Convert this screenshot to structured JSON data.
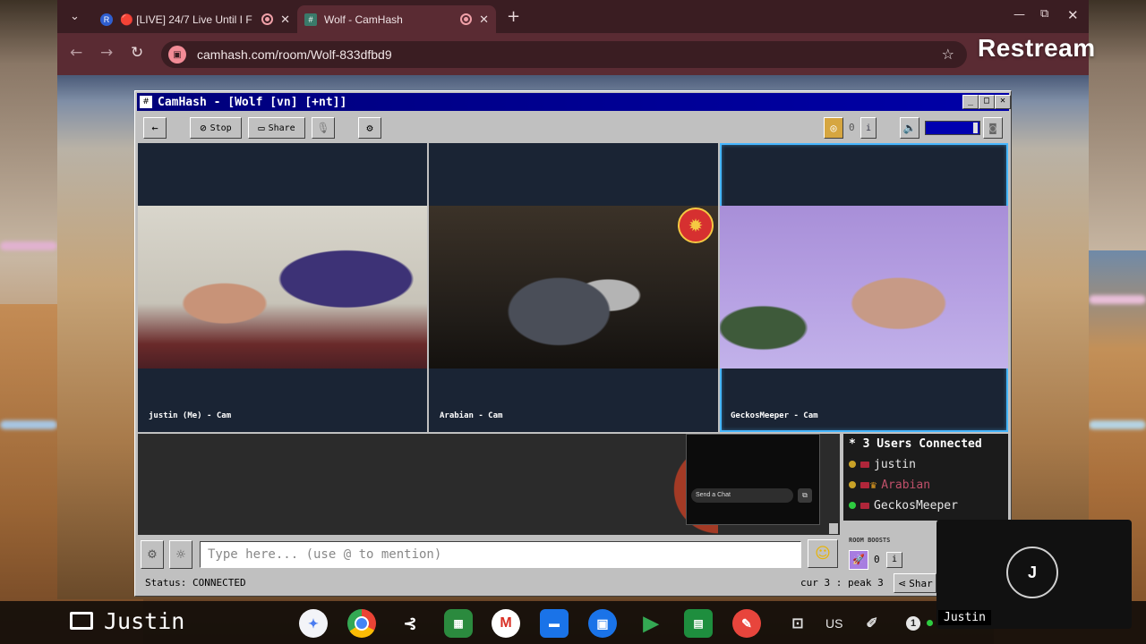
{
  "browser": {
    "tabs": [
      {
        "title": "🔴 [LIVE] 24/7 Live Until I F",
        "favicon": "R",
        "active": false
      },
      {
        "title": "Wolf - CamHash",
        "favicon": "#",
        "active": true
      }
    ],
    "url": "camhash.com/room/Wolf-833dfbd9"
  },
  "overlay": {
    "brand": "Restream"
  },
  "app": {
    "title": "CamHash - [Wolf [vn] [+nt]]",
    "toolbar": {
      "back_icon": "arrow-left-icon",
      "stop_label": "Stop",
      "share_label": "Share",
      "mic_icon": "microphone-icon",
      "settings_icon": "gear-icon",
      "coins_count": "0",
      "info_label": "i",
      "volume_icon": "speaker-icon",
      "camera_icon": "camera-icon"
    },
    "cams": [
      {
        "caption": "justin (Me) - Cam"
      },
      {
        "caption": "Arabian - Cam"
      },
      {
        "caption": "GeckosMeeper - Cam"
      }
    ],
    "chat": {
      "send_label": "Send a Chat",
      "input_placeholder": "Type here... (use @ to mention)"
    },
    "users": {
      "header": "* 3 Users Connected",
      "list": [
        {
          "name": "justin",
          "color": "#e6e6e6",
          "dot": "#c9a227",
          "crown": false
        },
        {
          "name": "Arabian",
          "color": "#c0506a",
          "dot": "#c9a227",
          "crown": true
        },
        {
          "name": "GeckosMeeper",
          "color": "#e6e6e6",
          "dot": "#2ecc40",
          "crown": false
        }
      ]
    },
    "boosts": {
      "label": "ROOM BOOSTS",
      "count": "0",
      "info": "i"
    },
    "status": "Status: CONNECTED",
    "peak": "cur 3 : peak 3",
    "share_label": "Shar"
  },
  "shelf": {
    "user_label": "Justin",
    "locale": "US",
    "notifications": "1",
    "apps": [
      "gemini-icon",
      "chrome-icon",
      "cast-icon",
      "apps-icon",
      "gmail-icon",
      "files-icon",
      "chat-icon",
      "play-store-icon",
      "meet-icon",
      "pencil-icon",
      "screenshot-icon"
    ]
  },
  "pip": {
    "initial": "J",
    "name": "Justin"
  }
}
